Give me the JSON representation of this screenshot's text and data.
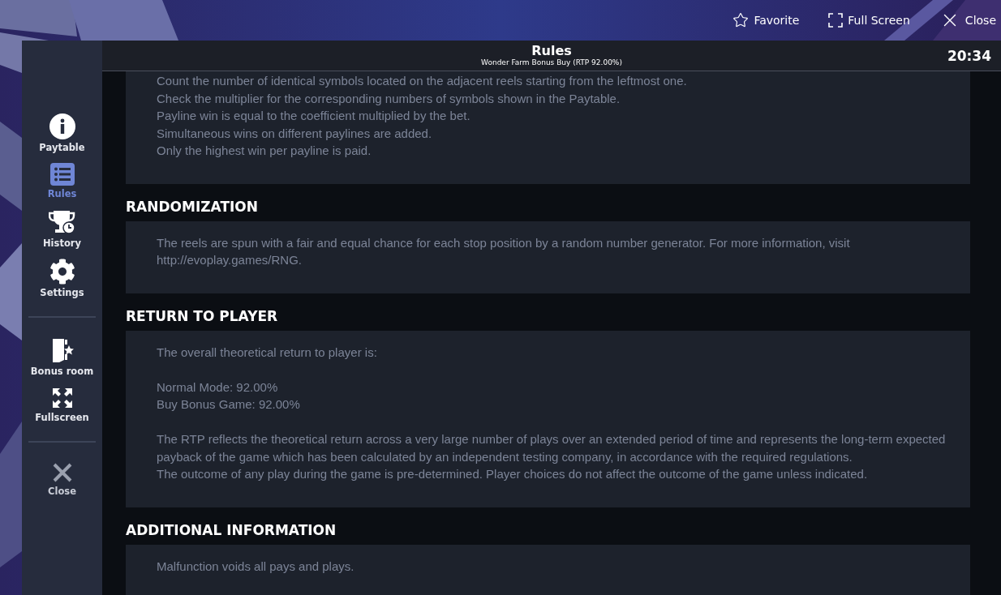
{
  "top_bar": {
    "actions": [
      {
        "label": "Favorite"
      },
      {
        "label": "Full Screen"
      },
      {
        "label": "Close"
      }
    ]
  },
  "sidebar": {
    "groups": [
      [
        {
          "label": "Paytable",
          "selected": false
        },
        {
          "label": "Rules",
          "selected": true
        },
        {
          "label": "History",
          "selected": false
        },
        {
          "label": "Settings",
          "selected": false
        }
      ],
      [
        {
          "label": "Bonus room",
          "selected": false
        },
        {
          "label": "Fullscreen",
          "selected": false
        }
      ],
      [
        {
          "label": "Close",
          "selected": false
        }
      ]
    ]
  },
  "header": {
    "title": "Rules",
    "subtitle": "Wonder Farm Bonus Buy (RTP 92.00%)",
    "time": "20:34"
  },
  "sections": [
    {
      "blocks": [
        [
          "Count the number of identical symbols located on the adjacent reels starting from the leftmost one.",
          "Check the multiplier for the corresponding numbers of symbols shown in the Paytable.",
          "Payline win is equal to the coefficient multiplied by the bet.",
          "Simultaneous wins on different paylines are added.",
          "Only the highest win per payline is paid."
        ]
      ]
    },
    {
      "heading": "RANDOMIZATION",
      "blocks": [
        [
          "The reels are spun with a fair and equal chance for each stop position by a random number generator. For more information, visit http://evoplay.games/RNG."
        ]
      ]
    },
    {
      "heading": "RETURN TO PLAYER",
      "blocks": [
        [
          "The overall theoretical return to player is:"
        ],
        [
          "Normal Mode: 92.00%",
          "Buy Bonus Game: 92.00%"
        ],
        [
          "The RTP reflects the theoretical return across a very large number of plays over an extended period of time and represents the long-term expected payback of the game which has been calculated by an independent testing company, in accordance with the required regulations.",
          "The outcome of any play during the game is pre-determined. Player choices do not affect the outcome of the game unless indicated."
        ]
      ]
    },
    {
      "heading": "ADDITIONAL INFORMATION",
      "blocks": [
        [
          "Malfunction voids all pays and plays."
        ]
      ]
    }
  ]
}
